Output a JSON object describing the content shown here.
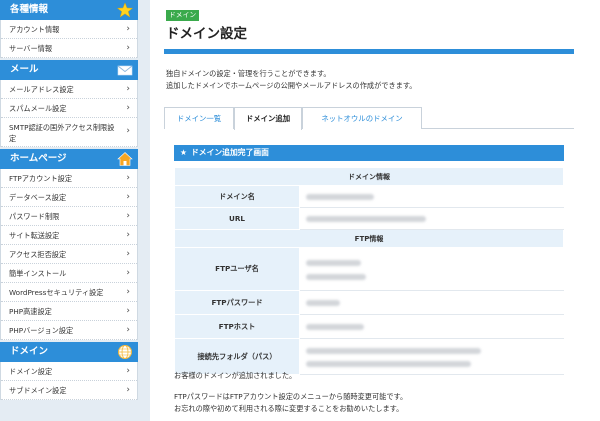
{
  "sidebar": {
    "sections": [
      {
        "title": "各種情報",
        "icon": "star-icon",
        "items": [
          "アカウント情報",
          "サーバー情報"
        ]
      },
      {
        "title": "メール",
        "icon": "mail-icon",
        "items": [
          "メールアドレス設定",
          "スパムメール設定",
          "SMTP認証の国外アクセス制限設定"
        ]
      },
      {
        "title": "ホームページ",
        "icon": "home-icon",
        "items": [
          "FTPアカウント設定",
          "データベース設定",
          "パスワード制限",
          "サイト転送設定",
          "アクセス拒否設定",
          "簡単インストール",
          "WordPressセキュリティ設定",
          "PHP高速設定",
          "PHPバージョン設定"
        ]
      },
      {
        "title": "ドメイン",
        "icon": "globe-icon",
        "items": [
          "ドメイン設定",
          "サブドメイン設定"
        ]
      }
    ]
  },
  "main": {
    "badge": "ドメイン",
    "title": "ドメイン設定",
    "description": [
      "独自ドメインの設定・管理を行うことができます。",
      "追加したドメインでホームページの公開やメールアドレスの作成ができます。"
    ],
    "tabs": [
      "ドメイン一覧",
      "ドメイン追加",
      "ネットオウルのドメイン"
    ],
    "active_tab": "ドメイン追加",
    "result_heading": "ドメイン追加完了画面",
    "domain_group": "ドメイン情報",
    "domain_rows": [
      {
        "label": "ドメイン名"
      },
      {
        "label": "URL"
      }
    ],
    "ftp_group": "FTP情報",
    "ftp_rows": [
      {
        "label": "FTPユーザ名"
      },
      {
        "label": "FTPパスワード"
      },
      {
        "label": "FTPホスト"
      },
      {
        "label": "接続先フォルダ（パス）"
      }
    ],
    "message": "お客様のドメインが追加されました。",
    "note": [
      "FTPパスワードはFTPアカウント設定のメニューから随時変更可能です。",
      "お忘れの際や初めて利用される際に変更することをお勧めいたします。"
    ]
  },
  "colors": {
    "accent": "#2d8ed9",
    "badge": "#3aaa4c",
    "label_bg": "#e6f1fa"
  }
}
